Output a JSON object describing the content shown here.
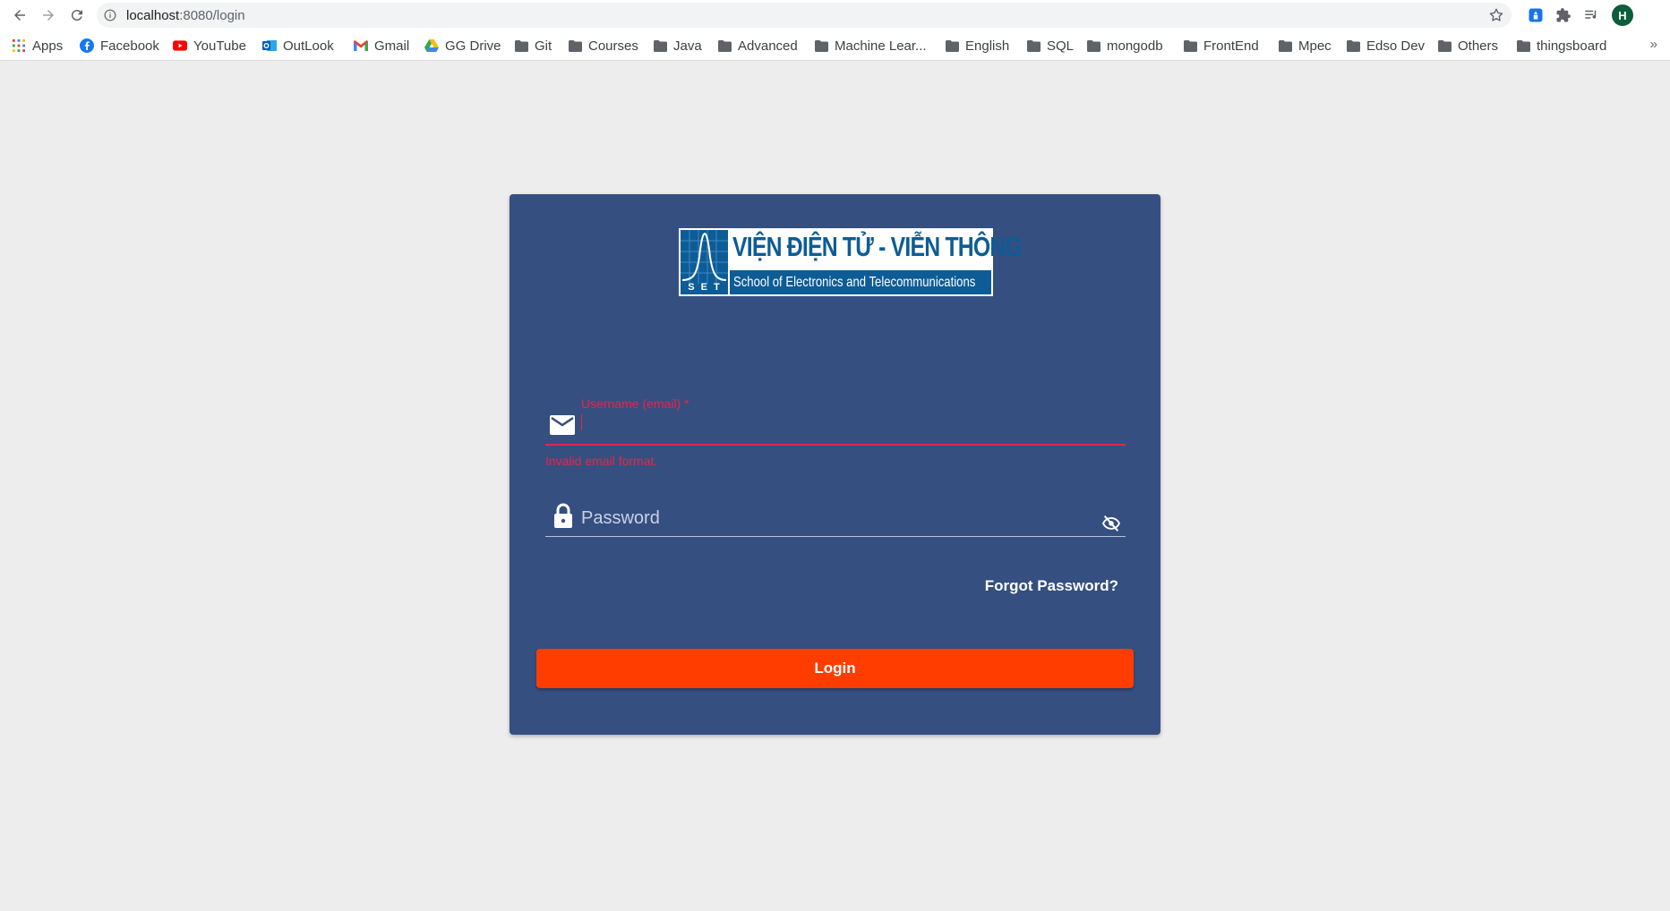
{
  "browser": {
    "url_host": "localhost",
    "url_path": ":8080/login",
    "profile_initial": "H",
    "bookmarks": [
      {
        "label": "Apps",
        "icon": "apps-grid-icon"
      },
      {
        "label": "Facebook",
        "icon": "facebook-icon"
      },
      {
        "label": "YouTube",
        "icon": "youtube-icon"
      },
      {
        "label": "OutLook",
        "icon": "outlook-icon"
      },
      {
        "label": "Gmail",
        "icon": "gmail-icon"
      },
      {
        "label": "GG Drive",
        "icon": "drive-icon"
      },
      {
        "label": "Git",
        "icon": "folder-icon"
      },
      {
        "label": "Courses",
        "icon": "folder-icon"
      },
      {
        "label": "Java",
        "icon": "folder-icon"
      },
      {
        "label": "Advanced",
        "icon": "folder-icon"
      },
      {
        "label": "Machine Lear...",
        "icon": "folder-icon"
      },
      {
        "label": "English",
        "icon": "folder-icon"
      },
      {
        "label": "SQL",
        "icon": "folder-icon"
      },
      {
        "label": "mongodb",
        "icon": "folder-icon"
      },
      {
        "label": "FrontEnd",
        "icon": "folder-icon"
      },
      {
        "label": "Mpec",
        "icon": "folder-icon"
      },
      {
        "label": "Edso Dev",
        "icon": "folder-icon"
      },
      {
        "label": "Others",
        "icon": "folder-icon"
      },
      {
        "label": "thingsboard",
        "icon": "folder-icon"
      }
    ],
    "more": "»"
  },
  "login": {
    "logo": {
      "title": "VIỆN ĐIỆN TỬ - VIỄN THÔNG",
      "subtitle": "School of Electronics and Telecommunications",
      "mark_text": "SET"
    },
    "username_label": "Username (email) *",
    "username_error": "Invalid email format.",
    "password_placeholder": "Password",
    "forgot_label": "Forgot Password?",
    "login_label": "Login"
  },
  "colors": {
    "page_bg": "#ededed",
    "card_bg": "#354f80",
    "error": "#e8244a",
    "login_button": "#ff3d00",
    "logo_blue": "#0d5c96"
  }
}
